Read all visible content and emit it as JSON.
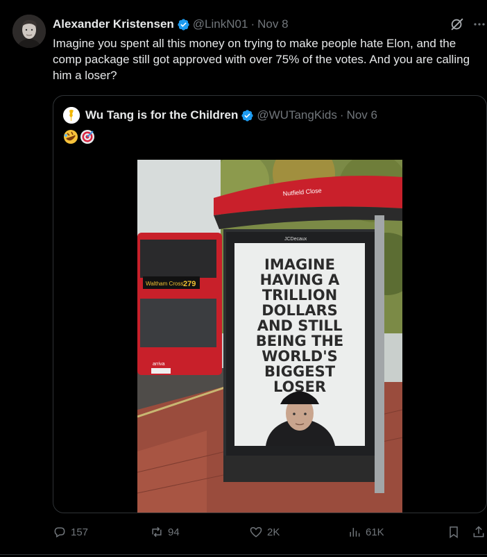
{
  "author": {
    "display_name": "Alexander Kristensen",
    "handle": "@LinkN01",
    "dot": "·",
    "date": "Nov 8"
  },
  "tweet_text": "Imagine you spent all this money on trying to make people hate Elon, and the comp package still got approved with over 75% of the votes. And you are calling him a loser?",
  "quoted": {
    "display_name": "Wu Tang is for the Children",
    "handle": "@WUTangKids",
    "dot": "·",
    "date": "Nov 6",
    "emojis": [
      "rolling-on-floor-laughing",
      "direct-hit"
    ],
    "image": {
      "shelter_sign": "Nutfield Close",
      "ad_brand": "JCDecaux",
      "bus_destination": "Waltham Cross",
      "bus_route": "279",
      "bus_operator": "arriva",
      "poster_lines": [
        "IMAGINE",
        "HAVING A",
        "TRILLION",
        "DOLLARS",
        "AND STILL",
        "BEING THE",
        "WORLD'S",
        "BIGGEST",
        "LOSER"
      ]
    }
  },
  "actions": {
    "replies": "157",
    "reposts": "94",
    "likes": "2K",
    "views": "61K"
  },
  "colors": {
    "background": "#000000",
    "text": "#e7e9ea",
    "muted": "#71767b",
    "verified": "#1d9bf0",
    "border": "#2f3336"
  }
}
